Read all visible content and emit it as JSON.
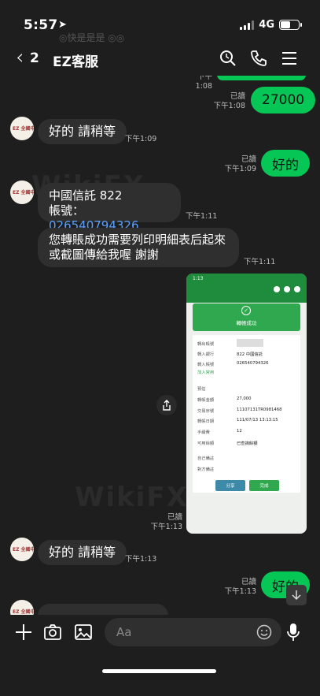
{
  "status_bar": {
    "time": "5:57",
    "network": "4G"
  },
  "ghost_text": "◎快是是是 ◎◎",
  "header": {
    "back_count": "2",
    "title": "EZ客服"
  },
  "avatar_text": "EZ 全國中華",
  "messages": {
    "top_partial_meta": "下午1:08",
    "m1": {
      "text": "27000",
      "read": "已讀",
      "time": "下午1:08"
    },
    "m2": {
      "text": "好的 請稍等",
      "time": "下午1:09"
    },
    "m3": {
      "text": "好的",
      "read": "已讀",
      "time": "下午1:09"
    },
    "m4": {
      "line1": "中國信託 822",
      "line2_label": "帳號：",
      "account": "026540794326",
      "time": "下午1:11"
    },
    "m5": {
      "line1": "您轉賬成功需要列印明細表后起來",
      "line2": "或截圖傳給我喔 謝謝",
      "time": "下午1:11"
    },
    "m6_image": {
      "time_label": "1:13",
      "banner": "轉帳成功",
      "rows": [
        {
          "k": "轉出帳號",
          "v": ""
        },
        {
          "k": "轉入銀行",
          "v": "822 中國信託"
        },
        {
          "k": "轉入帳號",
          "v": "026540794326"
        },
        {
          "k": "加入常用",
          "v": ""
        },
        {
          "k": "預估",
          "v": ""
        },
        {
          "k": "轉帳金額",
          "v": "27,000"
        },
        {
          "k": "交易序號",
          "v": "11107131TR0981468"
        },
        {
          "k": "轉帳日期",
          "v": "111/07/13 13:13:15"
        },
        {
          "k": "手續費",
          "v": "12"
        },
        {
          "k": "可用餘額",
          "v": "已查詢餘額"
        },
        {
          "k": "自己備註",
          "v": ""
        },
        {
          "k": "對方備註",
          "v": ""
        }
      ],
      "btn_share": "分享",
      "btn_done": "完成",
      "read": "已讀",
      "time": "下午1:13"
    },
    "m7": {
      "text": "好的 請稍等",
      "time": "下午1:13"
    },
    "m8": {
      "text": "好的",
      "read": "已讀",
      "time": "下午1:13"
    }
  },
  "composer": {
    "placeholder": "Aa"
  },
  "watermark": "WikiFX",
  "colors": {
    "bubble_out": "#06c755",
    "bubble_in": "#2f2f2f",
    "link": "#5aa0ff",
    "background": "#1e1e1e"
  }
}
